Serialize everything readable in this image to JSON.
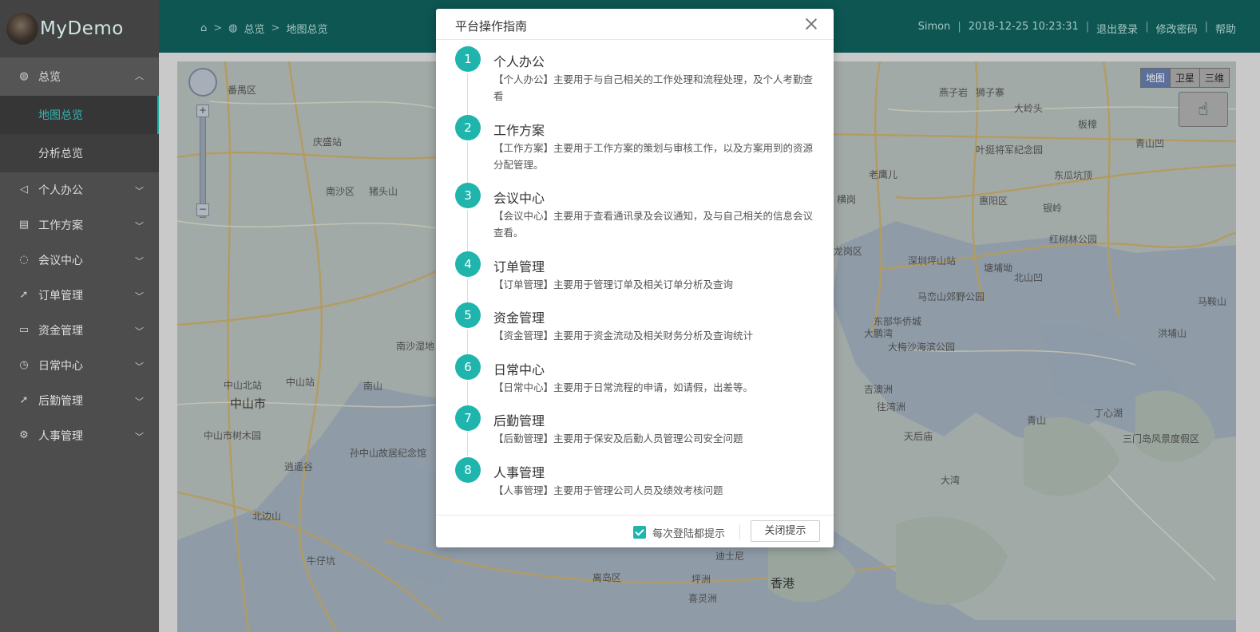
{
  "app": {
    "logo_text": "MyDemo"
  },
  "sidebar": {
    "items": [
      {
        "label": "总览",
        "icon": "globe-icon",
        "open": true
      },
      {
        "label": "个人办公",
        "icon": "megaphone-icon"
      },
      {
        "label": "工作方案",
        "icon": "document-icon"
      },
      {
        "label": "会议中心",
        "icon": "chat-icon"
      },
      {
        "label": "订单管理",
        "icon": "rocket-icon"
      },
      {
        "label": "资金管理",
        "icon": "video-icon"
      },
      {
        "label": "日常中心",
        "icon": "clock-icon"
      },
      {
        "label": "后勤管理",
        "icon": "rocket-icon"
      },
      {
        "label": "人事管理",
        "icon": "gear-icon"
      }
    ],
    "submenu": [
      {
        "label": "地图总览",
        "active": true
      },
      {
        "label": "分析总览"
      }
    ]
  },
  "header": {
    "breadcrumb": {
      "home_icon": "home-icon",
      "item1": "总览",
      "item2": "地图总览",
      "sep": ">"
    },
    "user": "Simon",
    "datetime": "2018-12-25 10:23:31",
    "logout": "退出登录",
    "change_password": "修改密码",
    "help": "帮助",
    "sep": "|"
  },
  "map": {
    "types": [
      "地图",
      "卫星",
      "三维"
    ],
    "labels": {
      "l1": "番禺区",
      "l2": "庆盛站",
      "l3": "南沙区",
      "l4": "猪头山",
      "l5": "中山北站",
      "l6": "中山站",
      "l7": "中山市",
      "l8": "南山",
      "l9": "中山市树木园",
      "l10": "逍遥谷",
      "l11": "孙中山故居纪念馆",
      "l12": "北边山",
      "l13": "牛仔坑",
      "l14": "南沙湿地",
      "l15": "横岗",
      "l16": "深圳坪山站",
      "l17": "马峦山郊野公园",
      "l18": "东部华侨城",
      "l19": "大梅沙海滨公园",
      "l20": "天后庙",
      "l21": "大湾",
      "l22": "青山",
      "l23": "丁心湖",
      "l24": "香港",
      "l25": "迪士尼",
      "l26": "离岛区",
      "l27": "燕子岩",
      "l28": "狮子寨",
      "l29": "大岭头",
      "l30": "板樟",
      "l31": "青山凹",
      "l32": "叶挺将军纪念园",
      "l33": "老鹰儿",
      "l34": "东瓜坑顶",
      "l35": "惠阳区",
      "l36": "红树林公园",
      "l37": "塘埔坳",
      "l38": "北山凹",
      "l39": "马鞍山",
      "l40": "洪埔山",
      "l41": "三门岛风景度假区",
      "l42": "坪洲",
      "l43": "喜灵洲",
      "l44": "银岭",
      "l45": "龙岗区",
      "l46": "大鹏湾",
      "l47": "吉澳洲",
      "l48": "往湾洲"
    }
  },
  "modal": {
    "title": "平台操作指南",
    "steps": [
      {
        "num": "1",
        "title": "个人办公",
        "desc": "【个人办公】主要用于与自己相关的工作处理和流程处理，及个人考勤查看"
      },
      {
        "num": "2",
        "title": "工作方案",
        "desc": "【工作方案】主要用于工作方案的策划与审核工作，以及方案用到的资源分配管理。"
      },
      {
        "num": "3",
        "title": "会议中心",
        "desc": "【会议中心】主要用于查看通讯录及会议通知，及与自己相关的信息会议查看。"
      },
      {
        "num": "4",
        "title": "订单管理",
        "desc": "【订单管理】主要用于管理订单及相关订单分析及查询"
      },
      {
        "num": "5",
        "title": "资金管理",
        "desc": "【资金管理】主要用于资金流动及相关财务分析及查询统计"
      },
      {
        "num": "6",
        "title": "日常中心",
        "desc": "【日常中心】主要用于日常流程的申请，如请假，出差等。"
      },
      {
        "num": "7",
        "title": "后勤管理",
        "desc": "【后勤管理】主要用于保安及后勤人员管理公司安全问题"
      },
      {
        "num": "8",
        "title": "人事管理",
        "desc": "【人事管理】主要用于管理公司人员及绩效考核问题"
      }
    ],
    "checkbox_label": "每次登陆都提示",
    "checkbox_checked": true,
    "close_button": "关闭提示"
  }
}
